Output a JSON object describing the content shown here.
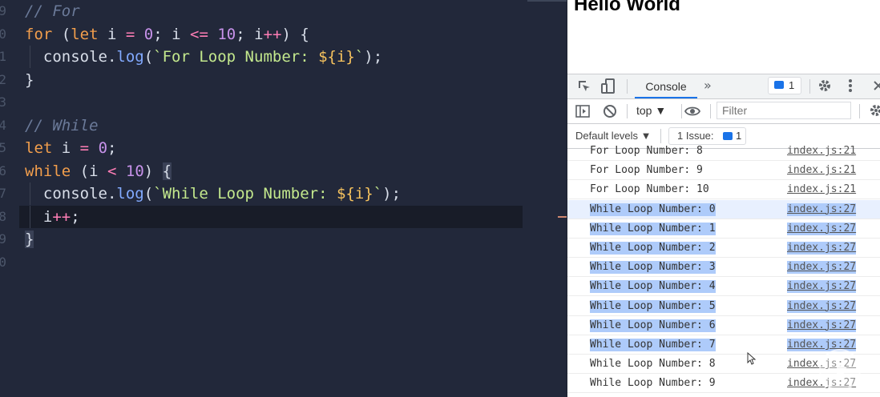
{
  "editor": {
    "lines": [
      {
        "num": "9",
        "tokens": [
          [
            "cm",
            "// For"
          ]
        ]
      },
      {
        "num": "0",
        "tokens": [
          [
            "kw",
            "for"
          ],
          [
            "pun",
            " ("
          ],
          [
            "kw",
            "let"
          ],
          [
            "pun",
            " i "
          ],
          [
            "op",
            "="
          ],
          [
            "pun",
            " "
          ],
          [
            "num",
            "0"
          ],
          [
            "pun",
            "; i "
          ],
          [
            "op",
            "<="
          ],
          [
            "pun",
            " "
          ],
          [
            "num",
            "10"
          ],
          [
            "pun",
            "; i"
          ],
          [
            "op",
            "++"
          ],
          [
            "pun",
            ") {"
          ]
        ]
      },
      {
        "num": "1",
        "indent": true,
        "tokens": [
          [
            "pun",
            "  console."
          ],
          [
            "fn",
            "log"
          ],
          [
            "pun",
            "("
          ],
          [
            "str",
            "`For Loop Number: "
          ],
          [
            "tpl",
            "${i}"
          ],
          [
            "str",
            "`"
          ],
          [
            "pun",
            ");"
          ]
        ]
      },
      {
        "num": "2",
        "tokens": [
          [
            "pun",
            "}"
          ]
        ]
      },
      {
        "num": "3",
        "tokens": []
      },
      {
        "num": "4",
        "tokens": [
          [
            "cm",
            "// While"
          ]
        ]
      },
      {
        "num": "5",
        "tokens": [
          [
            "kw",
            "let"
          ],
          [
            "pun",
            " i "
          ],
          [
            "op",
            "="
          ],
          [
            "pun",
            " "
          ],
          [
            "num",
            "0"
          ],
          [
            "pun",
            ";"
          ]
        ]
      },
      {
        "num": "6",
        "tokens": [
          [
            "kw",
            "while"
          ],
          [
            "pun",
            " (i "
          ],
          [
            "op",
            "<"
          ],
          [
            "pun",
            " "
          ],
          [
            "num",
            "10"
          ],
          [
            "pun",
            ") "
          ],
          [
            "brk",
            "{"
          ]
        ]
      },
      {
        "num": "7",
        "indent": true,
        "tokens": [
          [
            "pun",
            "  console."
          ],
          [
            "fn",
            "log"
          ],
          [
            "pun",
            "("
          ],
          [
            "str",
            "`While Loop Number: "
          ],
          [
            "tpl",
            "${i}"
          ],
          [
            "str",
            "`"
          ],
          [
            "pun",
            ");"
          ]
        ]
      },
      {
        "num": "8",
        "indent": true,
        "current": true,
        "tokens": [
          [
            "pun",
            "  i"
          ],
          [
            "op",
            "++"
          ],
          [
            "pun",
            ";"
          ]
        ]
      },
      {
        "num": "9",
        "tokens": [
          [
            "brk",
            "}"
          ]
        ]
      },
      {
        "num": "0",
        "tokens": []
      }
    ]
  },
  "page": {
    "heading": "Hello World"
  },
  "devtools": {
    "tab_console": "Console",
    "more_tabs": "»",
    "badge_count": "1",
    "context": "top ▼",
    "filter_placeholder": "Filter",
    "levels": "Default levels ▼",
    "issue_label": "1 Issue:",
    "issue_count": "1",
    "rows": [
      {
        "msg": "For Loop Number: 8",
        "src": "index.js:21",
        "selected": false,
        "focused": false
      },
      {
        "msg": "For Loop Number: 9",
        "src": "index.js:21",
        "selected": false,
        "focused": false
      },
      {
        "msg": "For Loop Number: 10",
        "src": "index.js:21",
        "selected": false,
        "focused": false
      },
      {
        "msg": "While Loop Number: 0",
        "src": "index.js:27",
        "selected": true,
        "focused": true
      },
      {
        "msg": "While Loop Number: 1",
        "src": "index.js:27",
        "selected": true,
        "focused": false
      },
      {
        "msg": "While Loop Number: 2",
        "src": "index.js:27",
        "selected": true,
        "focused": false
      },
      {
        "msg": "While Loop Number: 3",
        "src": "index.js:27",
        "selected": true,
        "focused": false
      },
      {
        "msg": "While Loop Number: 4",
        "src": "index.js:27",
        "selected": true,
        "focused": false
      },
      {
        "msg": "While Loop Number: 5",
        "src": "index.js:27",
        "selected": true,
        "focused": false
      },
      {
        "msg": "While Loop Number: 6",
        "src": "index.js:27",
        "selected": true,
        "focused": false
      },
      {
        "msg": "While Loop Number: 7",
        "src": "index.js:27",
        "selected": true,
        "focused": false
      },
      {
        "msg": "While Loop Number: 8",
        "src": "index.js:27",
        "selected": false,
        "focused": false
      },
      {
        "msg": "While Loop Number: 9",
        "src": "index.js:27",
        "selected": false,
        "focused": false
      }
    ]
  },
  "icons": [
    "inspect-icon",
    "device-toolbar-icon",
    "settings-gear-icon",
    "kebab-menu-icon",
    "close-icon",
    "sidebar-toggle-icon",
    "clear-console-icon",
    "eye-icon",
    "message-icon",
    "play-overlay-icon",
    "mouse-cursor-icon"
  ]
}
